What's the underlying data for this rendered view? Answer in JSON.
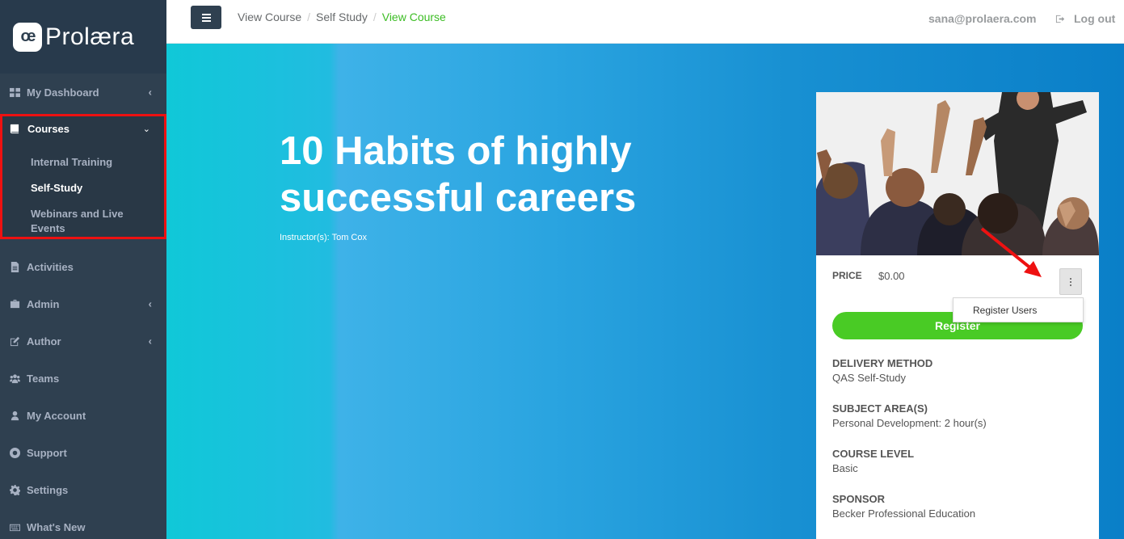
{
  "brand": {
    "logo_mark": "œ",
    "name": "Prolæra"
  },
  "sidebar": {
    "items": [
      {
        "label": "My Dashboard",
        "icon": "dashboard-icon"
      },
      {
        "label": "Courses",
        "icon": "book-icon"
      },
      {
        "label": "Activities",
        "icon": "file-icon"
      },
      {
        "label": "Admin",
        "icon": "briefcase-icon"
      },
      {
        "label": "Author",
        "icon": "edit-icon"
      },
      {
        "label": "Teams",
        "icon": "users-icon"
      },
      {
        "label": "My Account",
        "icon": "user-icon"
      },
      {
        "label": "Support",
        "icon": "life-ring-icon"
      },
      {
        "label": "Settings",
        "icon": "gear-icon"
      },
      {
        "label": "What's New",
        "icon": "keyboard-icon"
      }
    ],
    "courses_sub": [
      {
        "label": "Internal Training",
        "active": false
      },
      {
        "label": "Self-Study",
        "active": true
      },
      {
        "label": "Webinars and Live",
        "label2": "Events",
        "active": false
      }
    ]
  },
  "topbar": {
    "breadcrumbs": [
      "View Course",
      "Self Study",
      "View Course"
    ],
    "separator": "/",
    "user_email": "sana@prolaera.com",
    "logout_label": "Log out"
  },
  "course": {
    "title_line1": "10 Habits of highly",
    "title_line2": "successful careers",
    "instructor": "Instructor(s): Tom Cox",
    "price_label": "PRICE",
    "price": "$0.00",
    "register_label": "Register",
    "dropdown_item": "Register Users",
    "details": [
      {
        "label": "DELIVERY METHOD",
        "value": "QAS Self-Study"
      },
      {
        "label": "SUBJECT AREA(S)",
        "value": "Personal Development: 2 hour(s)"
      },
      {
        "label": "COURSE LEVEL",
        "value": "Basic"
      },
      {
        "label": "SPONSOR",
        "value": "Becker Professional Education"
      }
    ]
  },
  "colors": {
    "sidebar_bg": "#2f4050",
    "accent_green": "#49cb25",
    "breadcrumb_active": "#3cbd24",
    "highlight_box": "#ee1111"
  }
}
